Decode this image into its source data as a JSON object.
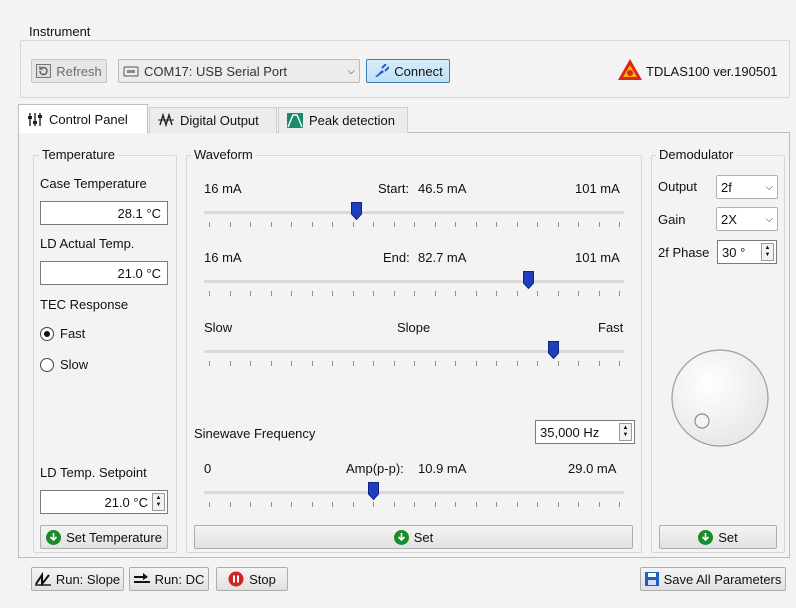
{
  "instrument": {
    "title": "Instrument",
    "refresh_label": "Refresh",
    "port_value": "COM17: USB Serial Port",
    "connect_label": "Connect",
    "device_version": "TDLAS100 ver.190501"
  },
  "tabs": [
    {
      "label": "Control Panel",
      "icon": "sliders-icon"
    },
    {
      "label": "Digital Output",
      "icon": "waveform-icon"
    },
    {
      "label": "Peak detection",
      "icon": "peak-icon"
    }
  ],
  "temperature": {
    "title": "Temperature",
    "case_label": "Case Temperature",
    "case_value": "28.1 °C",
    "ld_actual_label": "LD Actual Temp.",
    "ld_actual_value": "21.0 °C",
    "tec_label": "TEC Response",
    "fast_label": "Fast",
    "slow_label": "Slow",
    "tec_selected": "Fast",
    "setpoint_label": "LD Temp. Setpoint",
    "setpoint_value": "21.0 °C",
    "set_button": "Set Temperature"
  },
  "waveform": {
    "title": "Waveform",
    "start": {
      "min_label": "16 mA",
      "label": "Start:",
      "value": "46.5 mA",
      "max_label": "101 mA",
      "fraction": 0.36
    },
    "end": {
      "min_label": "16 mA",
      "label": "End:",
      "value": "82.7 mA",
      "max_label": "101 mA",
      "fraction": 0.78
    },
    "slope": {
      "min_label": "Slow",
      "label": "Slope",
      "max_label": "Fast",
      "fraction": 0.84
    },
    "sine_label": "Sinewave Frequency",
    "sine_value": "35,000 Hz",
    "amp": {
      "min_label": "0",
      "label": "Amp(p-p):",
      "value": "10.9 mA",
      "max_label": "29.0 mA",
      "fraction": 0.4
    },
    "set_button": "Set"
  },
  "demodulator": {
    "title": "Demodulator",
    "output_label": "Output",
    "output_value": "2f",
    "gain_label": "Gain",
    "gain_value": "2X",
    "phase_label": "2f Phase",
    "phase_value": "30 °",
    "set_button": "Set"
  },
  "bottom": {
    "run_slope": "Run: Slope",
    "run_dc": "Run: DC",
    "stop": "Stop",
    "save_all": "Save All Parameters"
  },
  "colors": {
    "accent_blue": "#1f3fbf",
    "green": "#1d8a2b",
    "stop_red": "#d32222",
    "warning_red": "#e0241b",
    "warning_yellow": "#f2b800"
  }
}
